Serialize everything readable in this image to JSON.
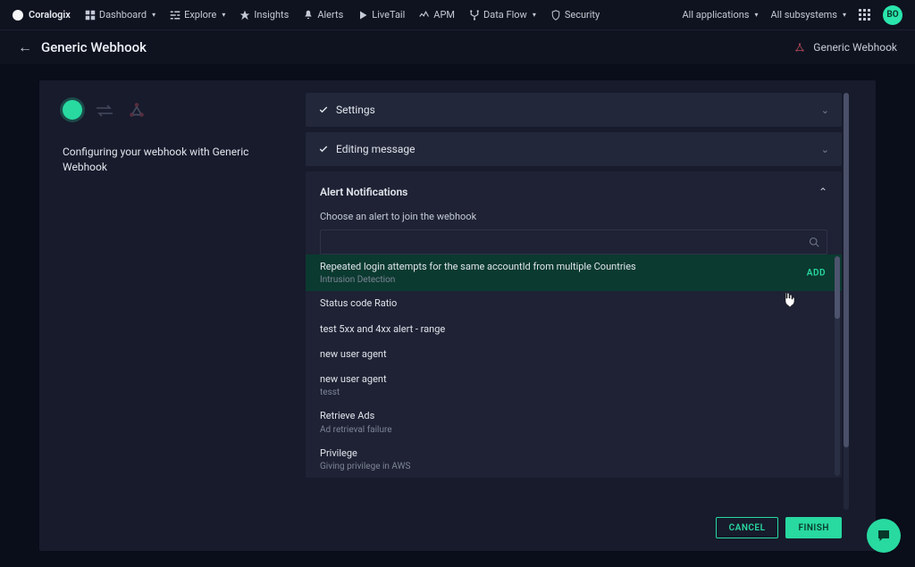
{
  "brand": "Coralogix",
  "nav": {
    "dashboard": "Dashboard",
    "explore": "Explore",
    "insights": "Insights",
    "alerts": "Alerts",
    "livetail": "LiveTail",
    "apm": "APM",
    "dataflow": "Data Flow",
    "security": "Security"
  },
  "filters": {
    "applications": "All applications",
    "subsystems": "All subsystems"
  },
  "user_initials": "BO",
  "page": {
    "title": "Generic Webhook",
    "header_right_label": "Generic Webhook"
  },
  "left": {
    "config_text": "Configuring your webhook with Generic Webhook"
  },
  "sections": {
    "settings": "Settings",
    "editing_message": "Editing message",
    "alert_notifications": "Alert Notifications",
    "choose_alert": "Choose an alert to join the webhook"
  },
  "alerts": [
    {
      "name": "Repeated login attempts for the same accountId from multiple Countries",
      "sub": "Intrusion Detection",
      "highlight": true
    },
    {
      "name": "Status code Ratio",
      "sub": ""
    },
    {
      "name": "test 5xx and 4xx alert - range",
      "sub": ""
    },
    {
      "name": "new user agent",
      "sub": ""
    },
    {
      "name": "new user agent",
      "sub": "tesst"
    },
    {
      "name": "Retrieve Ads",
      "sub": "Ad retrieval failure"
    },
    {
      "name": "Privilege",
      "sub": "Giving privilege in AWS"
    }
  ],
  "actions": {
    "add": "ADD",
    "cancel": "CANCEL",
    "finish": "FINISH"
  },
  "search_placeholder": ""
}
